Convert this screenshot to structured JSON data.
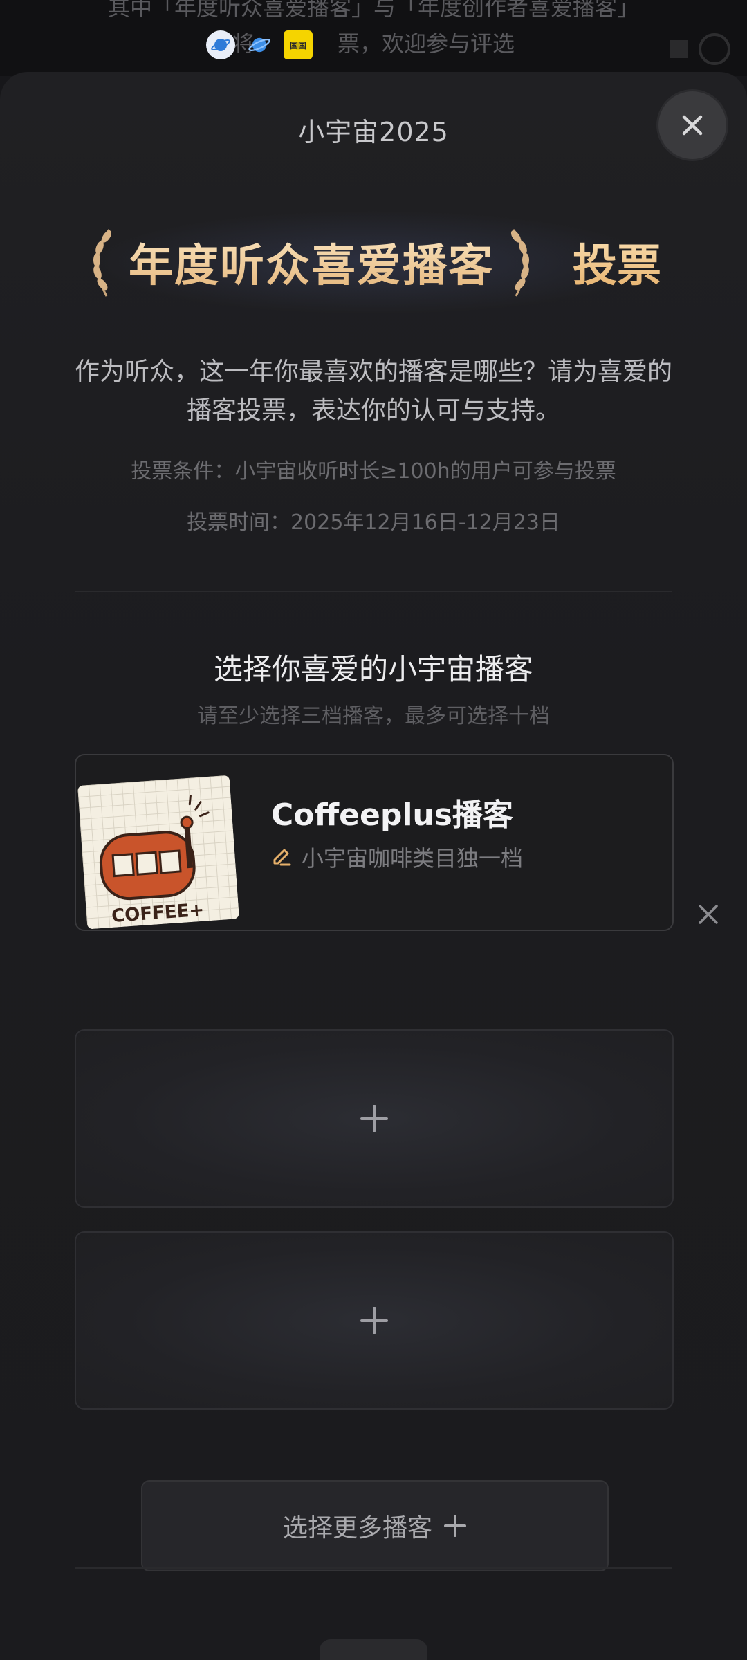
{
  "background": {
    "line1": "其中「年度听众喜爱播客」与「年度创作者喜爱播客」",
    "line2_left": "将",
    "line2_right": "票，欢迎参与评选",
    "app_badge": "国国"
  },
  "sheet": {
    "title": "小宇宙2025",
    "award_name": "年度听众喜爱播客",
    "award_suffix": "投票",
    "description": "作为听众，这一年你最喜欢的播客是哪些？请为喜爱的播客投票，表达你的认可与支持。",
    "condition": "投票条件：小宇宙收听时长≥100h的用户可参与投票",
    "vote_time": "投票时间：2025年12月16日-12月23日",
    "section_title": "选择你喜爱的小宇宙播客",
    "section_subtitle": "请至少选择三档播客，最多可选择十档",
    "selected_podcast": {
      "name": "Coffeeplus播客",
      "description": "小宇宙咖啡类目独一档",
      "cover_text": "COFFEE+"
    },
    "more_button": "选择更多播客"
  },
  "colors": {
    "accent_gold": "#e6b06a",
    "sheet_bg": "#1c1c1f",
    "cover_orange": "#c9542b"
  }
}
